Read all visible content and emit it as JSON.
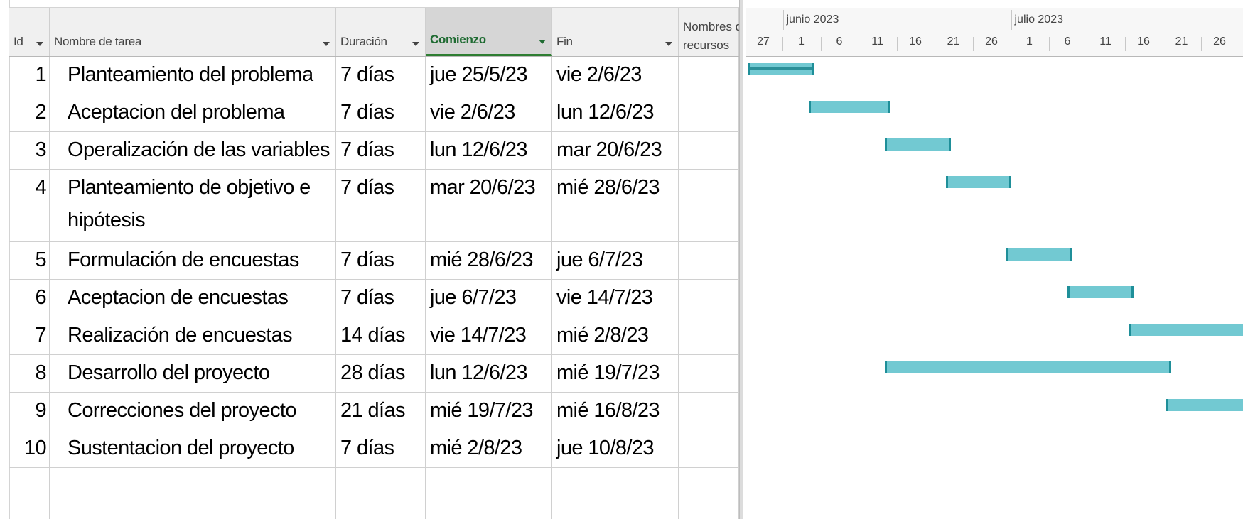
{
  "colors": {
    "bar_fill": "#72c9d2",
    "bar_edge": "#1f8f99",
    "sorted_header": "#1f6b32"
  },
  "headers": {
    "id": "Id",
    "name": "Nombre de tarea",
    "duration": "Duración",
    "start": "Comienzo",
    "finish": "Fin",
    "resources_line1": "Nombres d",
    "resources_line2": "recursos"
  },
  "timeline": {
    "months": [
      {
        "label": "junio 2023",
        "date": "2023-06-01"
      },
      {
        "label": "julio 2023",
        "date": "2023-07-01"
      }
    ],
    "ticks": [
      {
        "label": "27",
        "date": "2023-05-27"
      },
      {
        "label": "1",
        "date": "2023-06-01"
      },
      {
        "label": "6",
        "date": "2023-06-06"
      },
      {
        "label": "11",
        "date": "2023-06-11"
      },
      {
        "label": "16",
        "date": "2023-06-16"
      },
      {
        "label": "21",
        "date": "2023-06-21"
      },
      {
        "label": "26",
        "date": "2023-06-26"
      },
      {
        "label": "1",
        "date": "2023-07-01"
      },
      {
        "label": "6",
        "date": "2023-07-06"
      },
      {
        "label": "11",
        "date": "2023-07-11"
      },
      {
        "label": "16",
        "date": "2023-07-16"
      },
      {
        "label": "21",
        "date": "2023-07-21"
      },
      {
        "label": "26",
        "date": "2023-07-26"
      }
    ]
  },
  "tasks": [
    {
      "id": "1",
      "name": "Planteamiento del problema",
      "duration": "7 días",
      "start": "jue 25/5/23",
      "finish": "vie 2/6/23",
      "resources": "",
      "start_date": "2023-05-25",
      "finish_date": "2023-06-02",
      "progress": 1.0
    },
    {
      "id": "2",
      "name": "Aceptacion del problema",
      "duration": "7 días",
      "start": "vie 2/6/23",
      "finish": "lun 12/6/23",
      "resources": "",
      "start_date": "2023-06-02",
      "finish_date": "2023-06-12",
      "progress": 0
    },
    {
      "id": "3",
      "name": "Operalización de las variables",
      "duration": "7 días",
      "start": "lun 12/6/23",
      "finish": "mar 20/6/23",
      "resources": "",
      "start_date": "2023-06-12",
      "finish_date": "2023-06-20",
      "progress": 0
    },
    {
      "id": "4",
      "name": "Planteamiento de objetivo e hipótesis",
      "duration": "7 días",
      "start": "mar 20/6/23",
      "finish": "mié 28/6/23",
      "resources": "",
      "start_date": "2023-06-20",
      "finish_date": "2023-06-28",
      "progress": 0
    },
    {
      "id": "5",
      "name": "Formulación de encuestas",
      "duration": "7 días",
      "start": "mié 28/6/23",
      "finish": "jue 6/7/23",
      "resources": "",
      "start_date": "2023-06-28",
      "finish_date": "2023-07-06",
      "progress": 0
    },
    {
      "id": "6",
      "name": "Aceptacion de encuestas",
      "duration": "7 días",
      "start": "jue 6/7/23",
      "finish": "vie 14/7/23",
      "resources": "",
      "start_date": "2023-07-06",
      "finish_date": "2023-07-14",
      "progress": 0
    },
    {
      "id": "7",
      "name": "Realización de encuestas",
      "duration": "14 días",
      "start": "vie 14/7/23",
      "finish": "mié 2/8/23",
      "resources": "",
      "start_date": "2023-07-14",
      "finish_date": "2023-08-02",
      "progress": 0
    },
    {
      "id": "8",
      "name": "Desarrollo del proyecto",
      "duration": "28 días",
      "start": "lun 12/6/23",
      "finish": "mié 19/7/23",
      "resources": "",
      "start_date": "2023-06-12",
      "finish_date": "2023-07-19",
      "progress": 0
    },
    {
      "id": "9",
      "name": "Correcciones del proyecto",
      "duration": "21 días",
      "start": "mié 19/7/23",
      "finish": "mié 16/8/23",
      "resources": "",
      "start_date": "2023-07-19",
      "finish_date": "2023-08-16",
      "progress": 0
    },
    {
      "id": "10",
      "name": "Sustentacion del proyecto",
      "duration": "7 días",
      "start": "mié 2/8/23",
      "finish": "jue 10/8/23",
      "resources": "",
      "start_date": "2023-08-02",
      "finish_date": "2023-08-10",
      "progress": 0
    }
  ]
}
